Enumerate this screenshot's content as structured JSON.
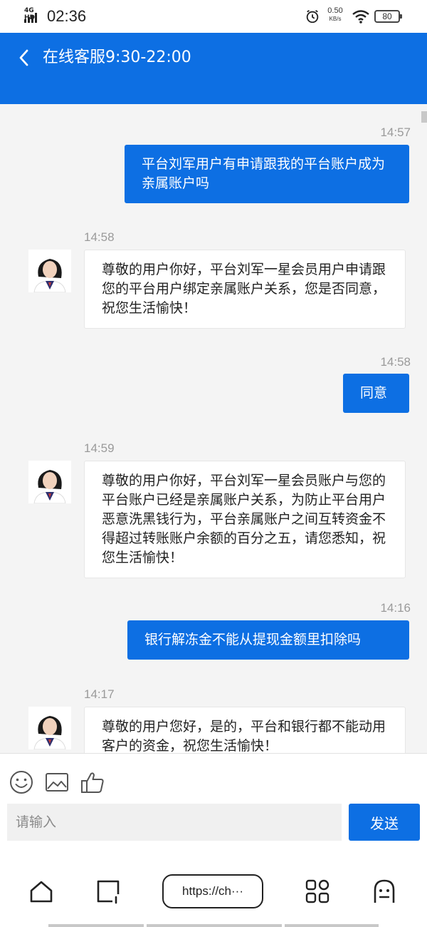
{
  "status_bar": {
    "network": "4G HD",
    "time": "02:36",
    "speed_value": "0.50",
    "speed_unit": "KB/s",
    "battery": "80"
  },
  "header": {
    "title": "在线客服9:30-22:00"
  },
  "messages": [
    {
      "time": "14:57",
      "direction": "out",
      "text": "平台刘军用户有申请跟我的平台账户成为亲属账户吗"
    },
    {
      "time": "14:58",
      "direction": "in",
      "text": "尊敬的用户你好，平台刘军一星会员用户申请跟您的平台用户绑定亲属账户关系，您是否同意，祝您生活愉快！"
    },
    {
      "time": "14:58",
      "direction": "out",
      "text": "同意"
    },
    {
      "time": "14:59",
      "direction": "in",
      "text": "尊敬的用户你好，平台刘军一星会员账户与您的平台账户已经是亲属账户关系，为防止平台用户恶意洗黑钱行为，平台亲属账户之间互转资金不得超过转账账户余额的百分之五，请您悉知，祝您生活愉快！"
    },
    {
      "time": "14:16",
      "direction": "out",
      "text": "银行解冻金不能从提现金额里扣除吗"
    },
    {
      "time": "14:17",
      "direction": "in",
      "text": "尊敬的用户您好，是的，平台和银行都不能动用客户的资金，祝您生活愉快！"
    }
  ],
  "composer": {
    "placeholder": "请输入",
    "send_label": "发送"
  },
  "browser": {
    "url": "https://ch···"
  },
  "colors": {
    "accent": "#0d6fe3",
    "background": "#f4f4f4"
  }
}
